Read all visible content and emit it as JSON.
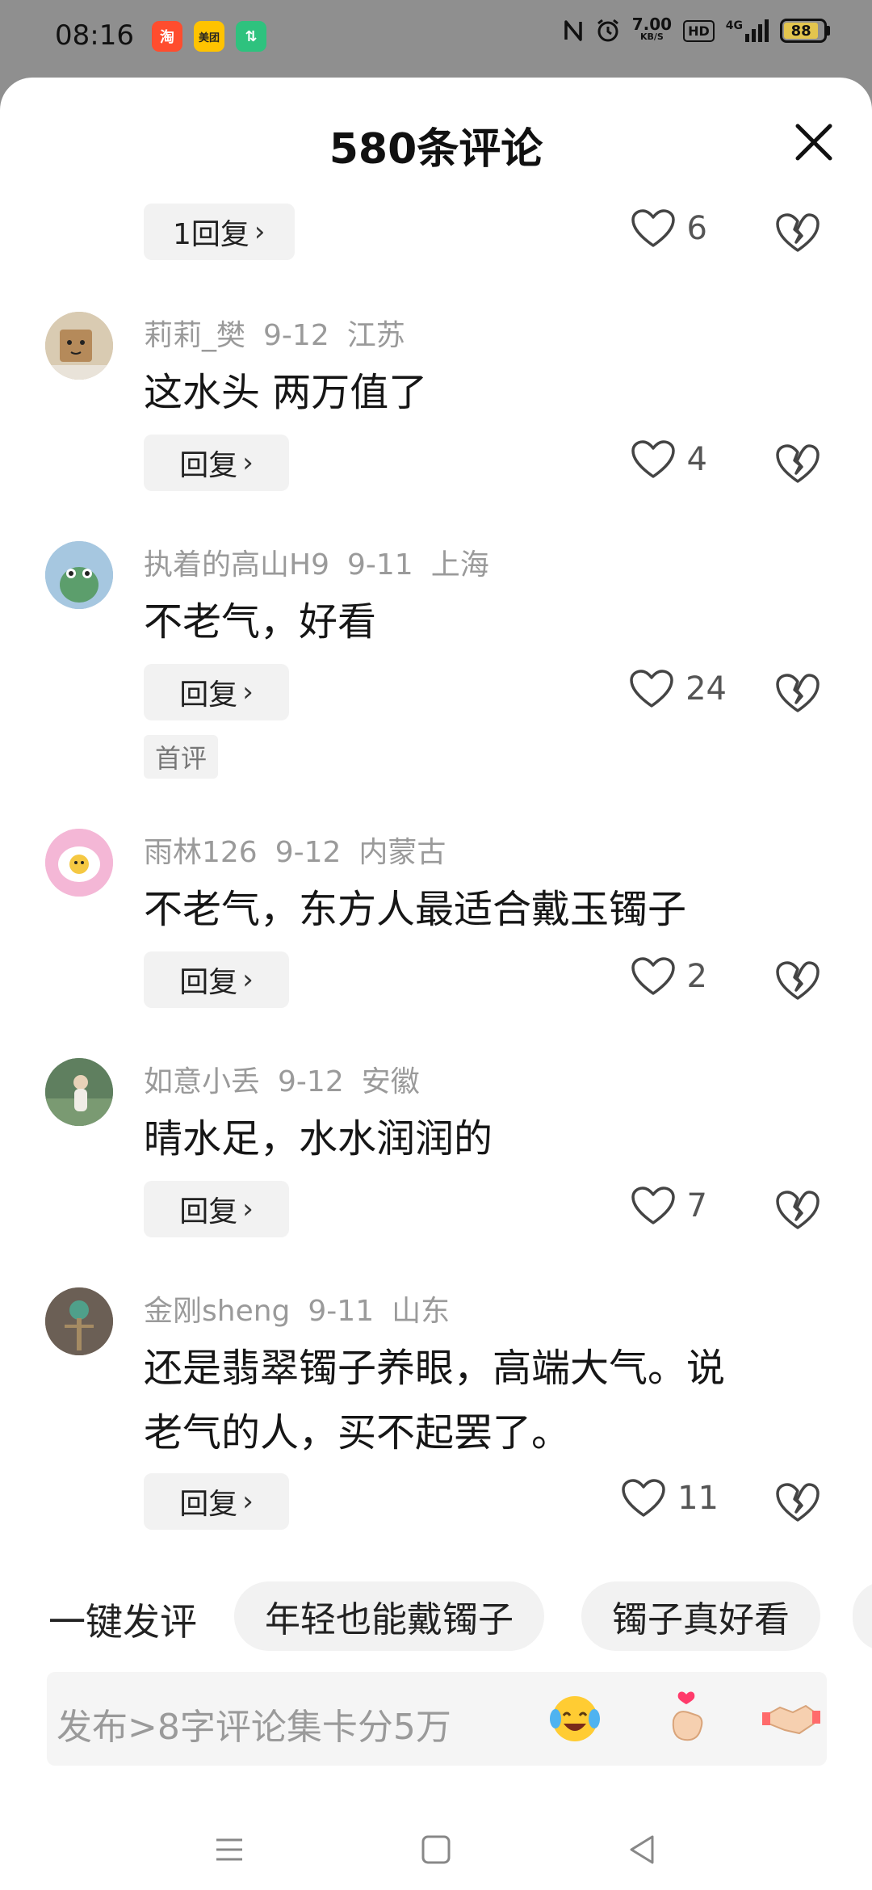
{
  "status": {
    "time": "08:16",
    "apps": [
      {
        "icon": "taobao-icon",
        "label": "淘",
        "color": "#ff4d2e"
      },
      {
        "icon": "meituan-icon",
        "label": "美团",
        "color": "#ffc300"
      },
      {
        "icon": "transfer-icon",
        "label": "⇅",
        "color": "#2ec27e"
      }
    ],
    "speed_value": "7.00",
    "speed_unit": "KB/S",
    "hd": "HD",
    "network": "4G",
    "battery": "88"
  },
  "sheet": {
    "title": "580条评论",
    "close_icon": "close-icon"
  },
  "comments": [
    {
      "reply_label": "1回复",
      "likes": "6"
    },
    {
      "user": "莉莉_樊",
      "date": "9-12",
      "location": "江苏",
      "text": "这水头 两万值了",
      "reply_label": "回复",
      "likes": "4"
    },
    {
      "user": "执着的高山H9",
      "date": "9-11",
      "location": "上海",
      "text": "不老气，好看",
      "reply_label": "回复",
      "likes": "24",
      "badge": "首评"
    },
    {
      "user": "雨林126",
      "date": "9-12",
      "location": "内蒙古",
      "text": "不老气，东方人最适合戴玉镯子",
      "reply_label": "回复",
      "likes": "2"
    },
    {
      "user": "如意小丢",
      "date": "9-12",
      "location": "安徽",
      "text": "晴水足，水水润润的",
      "reply_label": "回复",
      "likes": "7"
    },
    {
      "user": "金刚sheng",
      "date": "9-11",
      "location": "山东",
      "text_line1": "还是翡翠镯子养眼，高端大气。说",
      "text_line2": "老气的人，买不起罢了。",
      "reply_label": "回复",
      "likes": "11"
    }
  ],
  "quick": {
    "label": "一键发评",
    "chips": [
      "年轻也能戴镯子",
      "镯子真好看"
    ]
  },
  "input": {
    "placeholder": "发布>8字评论集卡分5万",
    "emojis": [
      "laughing-crying-emoji",
      "finger-heart-emoji",
      "handshake-emoji"
    ]
  },
  "nav": {
    "icons": [
      "menu-icon",
      "home-icon",
      "back-icon"
    ]
  }
}
